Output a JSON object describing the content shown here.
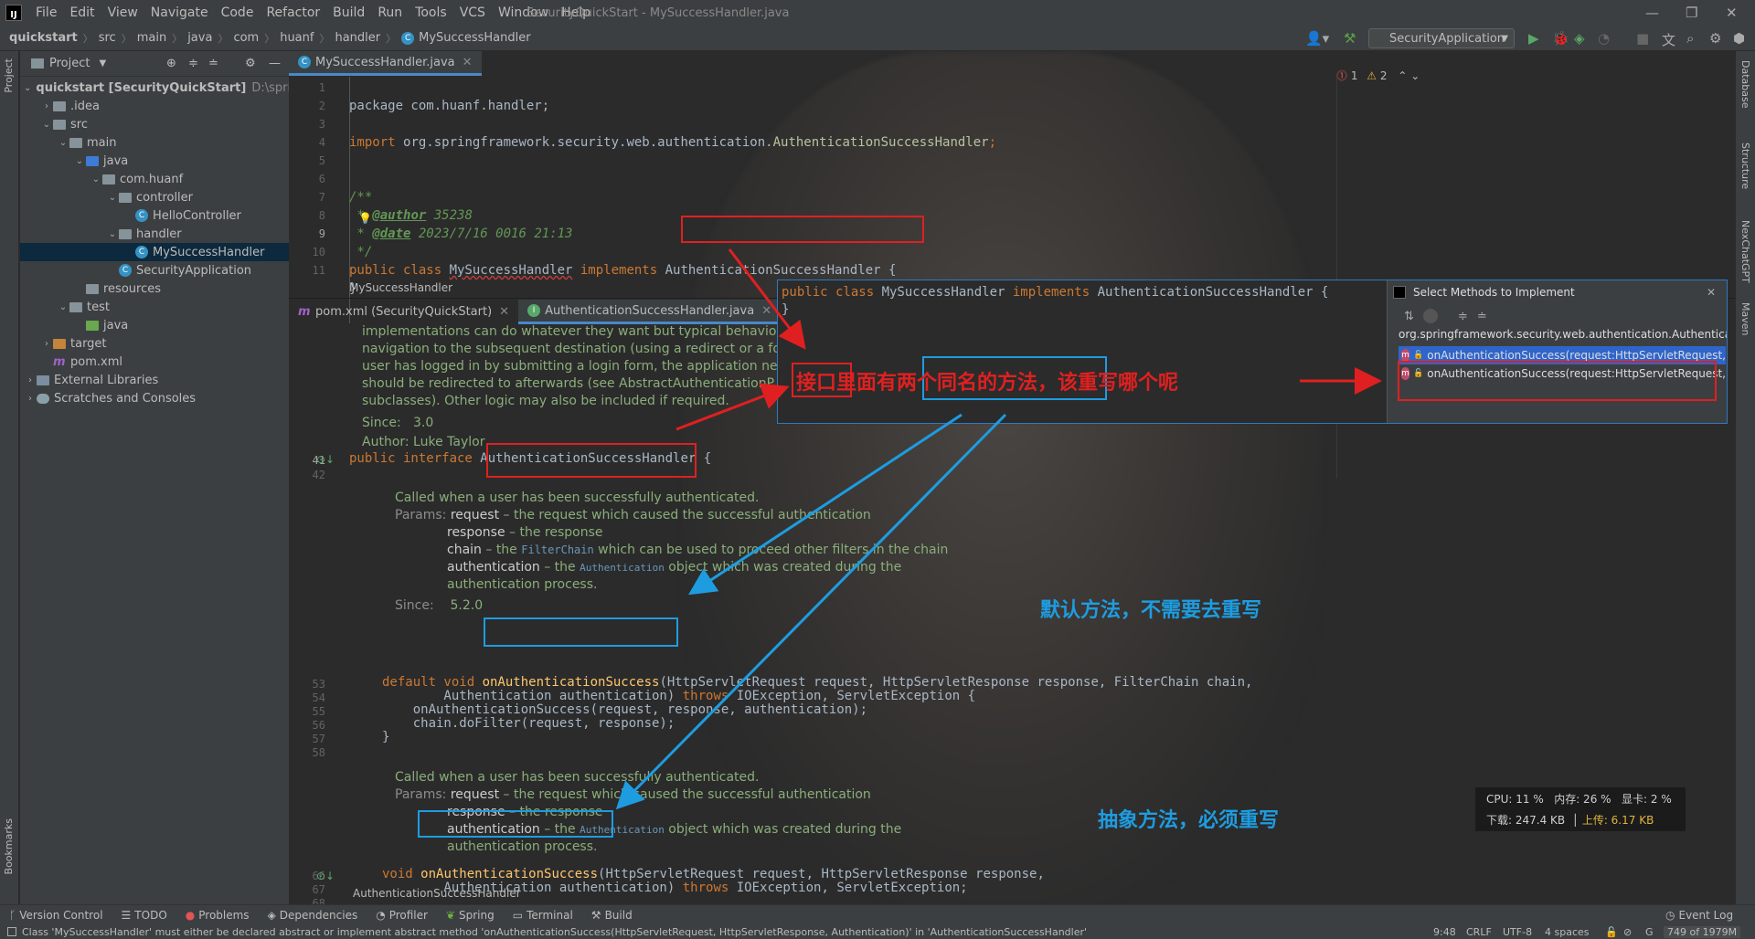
{
  "window": {
    "title": "SecurityQuickStart - MySuccessHandler.java",
    "menu": [
      "File",
      "Edit",
      "View",
      "Navigate",
      "Code",
      "Refactor",
      "Build",
      "Run",
      "Tools",
      "VCS",
      "Window",
      "Help"
    ]
  },
  "breadcrumb": [
    "quickstart",
    "src",
    "main",
    "java",
    "com",
    "huanf",
    "handler",
    "MySuccessHandler"
  ],
  "run_config": "SecurityApplication",
  "left_strip": {
    "project": "Project",
    "bookmarks": "Bookmarks"
  },
  "right_strip": [
    "Database",
    "Structure",
    "NexChatGPT",
    "Maven"
  ],
  "project_panel": {
    "title": "Project",
    "tree": [
      {
        "label": "quickstart [SecurityQuickStart]",
        "suffix": "D:\\springs",
        "depth": 0,
        "chev": "v",
        "icon": "folder-grey"
      },
      {
        "label": ".idea",
        "depth": 1,
        "chev": ">",
        "icon": "folder-grey"
      },
      {
        "label": "src",
        "depth": 1,
        "chev": "v",
        "icon": "folder-grey"
      },
      {
        "label": "main",
        "depth": 2,
        "chev": "v",
        "icon": "folder-grey"
      },
      {
        "label": "java",
        "depth": 3,
        "chev": "v",
        "icon": "folder-blue"
      },
      {
        "label": "com.huanf",
        "depth": 4,
        "chev": "v",
        "icon": "folder-grey"
      },
      {
        "label": "controller",
        "depth": 5,
        "chev": "v",
        "icon": "folder-grey"
      },
      {
        "label": "HelloController",
        "depth": 6,
        "chev": "",
        "icon": "class"
      },
      {
        "label": "handler",
        "depth": 5,
        "chev": "v",
        "icon": "folder-grey"
      },
      {
        "label": "MySuccessHandler",
        "depth": 6,
        "chev": "",
        "icon": "class",
        "selected": true
      },
      {
        "label": "SecurityApplication",
        "depth": 5,
        "chev": "",
        "icon": "class"
      },
      {
        "label": "resources",
        "depth": 3,
        "chev": "",
        "icon": "folder-grey"
      },
      {
        "label": "test",
        "depth": 2,
        "chev": "v",
        "icon": "folder-grey"
      },
      {
        "label": "java",
        "depth": 3,
        "chev": "",
        "icon": "folder-green"
      },
      {
        "label": "target",
        "depth": 1,
        "chev": ">",
        "icon": "folder-orange"
      },
      {
        "label": "pom.xml",
        "depth": 1,
        "chev": "",
        "icon": "maven"
      },
      {
        "label": "External Libraries",
        "depth": 0,
        "chev": ">",
        "icon": "lib"
      },
      {
        "label": "Scratches and Consoles",
        "depth": 0,
        "chev": ">",
        "icon": "scratch"
      }
    ]
  },
  "editor_top": {
    "tab": "MySuccessHandler.java",
    "line_numbers": [
      "1",
      "2",
      "3",
      "4",
      "5",
      "6",
      "7",
      "8",
      "9",
      "10",
      "11"
    ],
    "warnings": {
      "errors": "1",
      "warnings": "2"
    },
    "lines": {
      "l1": "package com.huanf.handler;",
      "l3a": "import ",
      "l3b": "org.springframework.security.web.authentication.",
      "l3c": "AuthenticationSuccessHandler",
      "l3d": ";",
      "l6": "/**",
      "l7a": " * ",
      "l7b": "@author",
      "l7c": " 35238",
      "l8a": " * ",
      "l8b": "@date",
      "l8c": " 2023/7/16 0016 21:13",
      "l9x": " */",
      "l9a": "public class ",
      "l9b": "MySuccessHandler",
      "l9c": " implements ",
      "l9d": "AuthenticationSuccessHandler",
      "l9e": " {",
      "l10": "}"
    },
    "footer": "MySuccessHandler"
  },
  "editor_bottom": {
    "tabs": [
      "pom.xml (SecurityQuickStart)",
      "AuthenticationSuccessHandler.java"
    ],
    "doc_top": [
      "implementations can do whatever they want but typical behaviour",
      "navigation to the subsequent destination (using a redirect or a forw",
      "user has logged in by submitting a login form, the application need",
      "should be redirected to afterwards (see AbstractAuthenticationP",
      "subclasses). Other logic may also be included if required."
    ],
    "since_label": "Since:",
    "since_val": "3.0",
    "author_line": "Author: Luke Taylor",
    "ln41": "41",
    "ln42": "42",
    "iface_a": "public interface ",
    "iface_b": "AuthenticationSuccessHandler",
    "iface_c": " {",
    "doc1": {
      "desc": "Called when a user has been successfully authenticated.",
      "params_label": "Params:",
      "p1n": "request",
      "p1d": " – the request which caused the successful authentication",
      "p2n": "response",
      "p2d": " – the response",
      "p3n": "chain",
      "p3d1": " – the ",
      "p3code": "FilterChain",
      "p3d2": " which can be used to proceed other filters in the chain",
      "p4n": "authentication",
      "p4d1": " – the ",
      "p4code": "Authentication",
      "p4d2": " object which was created during the",
      "p4d3": "authentication process.",
      "since_label": "Since:",
      "since_val": "5.2.0"
    },
    "m1_lines": [
      "53",
      "54",
      "55",
      "56",
      "57",
      "58"
    ],
    "m1a": "default void ",
    "m1b": "onAuthenticationSuccess",
    "m1c": "(HttpServletRequest request, HttpServletResponse response, FilterChain chain,",
    "m1d": "        Authentication authentication) ",
    "m1e": "throws ",
    "m1f": "IOException, ServletException {",
    "m1g": "    onAuthenticationSuccess(request, response, authentication);",
    "m1h": "    chain.doFilter(request, response);",
    "m1i": "}",
    "doc2": {
      "desc": "Called when a user has been successfully authenticated.",
      "params_label": "Params:",
      "p1n": "request",
      "p1d": " – the request which caused the successful authentication",
      "p2n": "response",
      "p2d": " – the response",
      "p4n": "authentication",
      "p4d1": " – the ",
      "p4code": "Authentication",
      "p4d2": " object which was created during the",
      "p4d3": "authentication process."
    },
    "m2_lines": [
      "66",
      "67",
      "68",
      "69"
    ],
    "m2a": "void ",
    "m2b": "onAuthenticationSuccess",
    "m2c": "(HttpServletRequest request, HttpServletResponse response,",
    "m2d": "        Authentication authentication) ",
    "m2e": "throws ",
    "m2f": "IOException, ServletException;",
    "m2g": "}",
    "footer": "AuthenticationSuccessHandler"
  },
  "popup": {
    "line_a": "public class ",
    "line_b": "MySuccessHandler",
    "line_c": " implements ",
    "line_d": "AuthenticationSuccessHandler",
    "line_e": " {",
    "line_2": "}",
    "title": "Select Methods to Implement",
    "group": "org.springframework.security.web.authentication.Authentica",
    "methods": [
      "onAuthenticationSuccess(request:HttpServletRequest,",
      "onAuthenticationSuccess(request:HttpServletRequest,"
    ]
  },
  "annotations": {
    "main_a": "接口",
    "main_b": "里面有",
    "main_c": "两个同名的方法",
    "main_d": "，该重写哪个呢",
    "default_note": "默认方法，不需要去重写",
    "abstract_note": "抽象方法，必须重写"
  },
  "netmon": {
    "cpu": "CPU: 11 %",
    "mem": "内存: 26 %",
    "gpu": "显卡: 2 %",
    "down": "下载: 247.4 KB",
    "up": "上传: 6.17 KB"
  },
  "bottom_tools": [
    "Version Control",
    "TODO",
    "Problems",
    "Dependencies",
    "Profiler",
    "Spring",
    "Terminal",
    "Build"
  ],
  "event_log": "Event Log",
  "status": {
    "message": "Class 'MySuccessHandler' must either be declared abstract or implement abstract method 'onAuthenticationSuccess(HttpServletRequest, HttpServletResponse, Authentication)' in 'AuthenticationSuccessHandler'",
    "pos": "9:48",
    "crlf": "CRLF",
    "enc": "UTF-8",
    "indent": "4 spaces",
    "mem": "749 of 1979M"
  },
  "colors": {
    "red": "#e02020",
    "blue": "#1e9ce0",
    "bg": "#2b2b2b"
  }
}
